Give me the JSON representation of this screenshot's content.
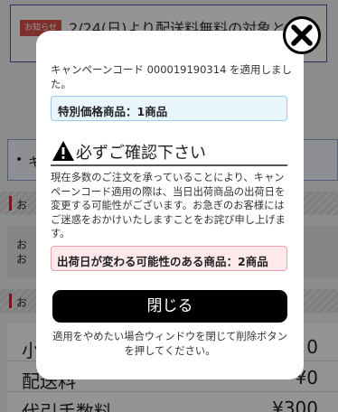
{
  "background": {
    "notice": {
      "badge": "お知らせ",
      "text": "2/24(日)より配送料無料の対象となる"
    },
    "info_box": {
      "text": "キ"
    },
    "sections": [
      {
        "title": "お"
      },
      {
        "title": "お"
      }
    ],
    "gray_box_lines": [
      "お",
      "お"
    ],
    "summary_rows": [
      {
        "label": "小",
        "value": "0"
      },
      {
        "label": "配送料",
        "value": "¥0"
      },
      {
        "label": "代引手数料",
        "value": "¥300"
      }
    ]
  },
  "modal": {
    "campaign_message": "キャンペーンコード 000019190314 を適用しました。",
    "special_price_label": "特別価格商品：1商品",
    "confirm_title": "必ずご確認下さい",
    "notice_text": "現在多数のご注文を承っていることにより、キャンペーンコード適用の際は、当日出荷商品の出荷日を変更する可能性がございます。お急ぎのお客様にはご迷惑をおかけいたしますことをお詫び申し上げます。",
    "shipping_change_label": "出荷日が変わる可能性のある商品：2商品",
    "close_button_label": "閉じる",
    "footer_note": "適用をやめたい場合ウィンドウを閉じて削除ボタンを押してください。",
    "close_icon": "close-x-icon",
    "warning_icon": "warning-triangle-icon"
  },
  "colors": {
    "special_box_bg": "#e8f5fd",
    "shipping_box_bg": "#fde9ec",
    "button_bg": "#000000",
    "notice_badge": "#d9534f",
    "section_marker": "#cc2233"
  }
}
